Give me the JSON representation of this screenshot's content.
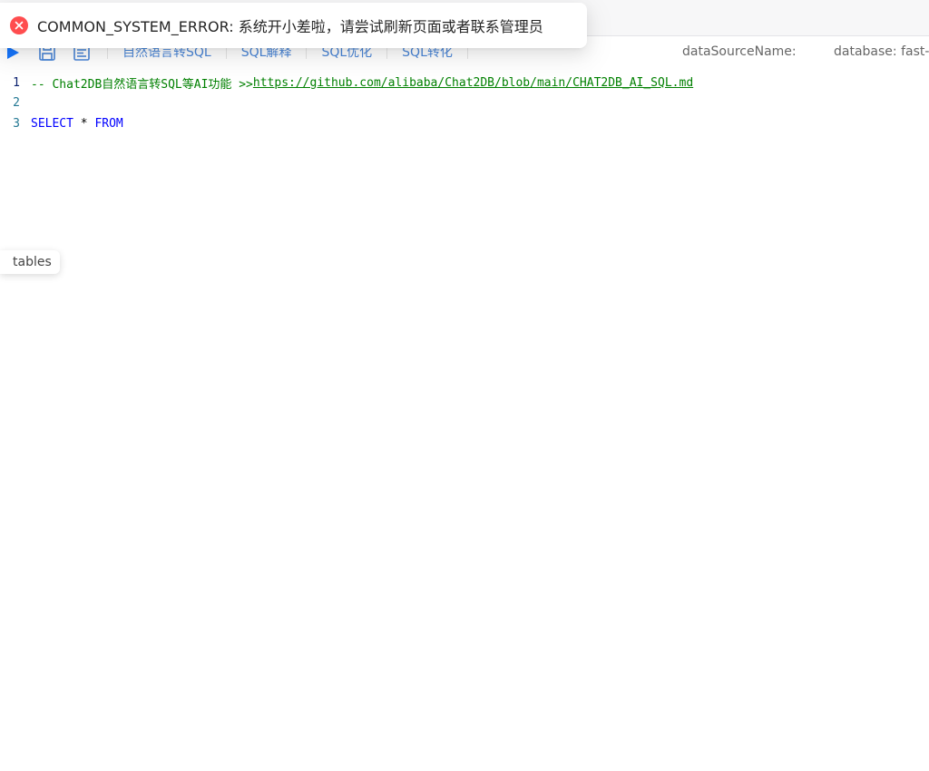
{
  "notification": {
    "message": "COMMON_SYSTEM_ERROR: 系统开小差啦，请尝试刷新页面或者联系管理员",
    "icon": "error-circle-icon",
    "color": "#ff4d4f"
  },
  "toolbar": {
    "icons": [
      "run-icon",
      "save-icon",
      "format-icon"
    ],
    "accent_color": "#1677ff",
    "ai_buttons": [
      {
        "label": "自然语言转SQL"
      },
      {
        "label": "SQL解释"
      },
      {
        "label": "SQL优化"
      },
      {
        "label": "SQL转化"
      }
    ],
    "data_source_label": "dataSourceName:",
    "database_label": "database: fast-jp"
  },
  "editor": {
    "lines": [
      {
        "number": "1",
        "comment": "-- Chat2DB自然语言转SQL等AI功能 >> ",
        "link": "https://github.com/alibaba/Chat2DB/blob/main/CHAT2DB_AI_SQL.md"
      },
      {
        "number": "2",
        "text": ""
      },
      {
        "number": "3",
        "kw1": "SELECT",
        "op": " * ",
        "kw2": "FROM"
      }
    ]
  },
  "side_panel": {
    "tables_label": "tables"
  }
}
